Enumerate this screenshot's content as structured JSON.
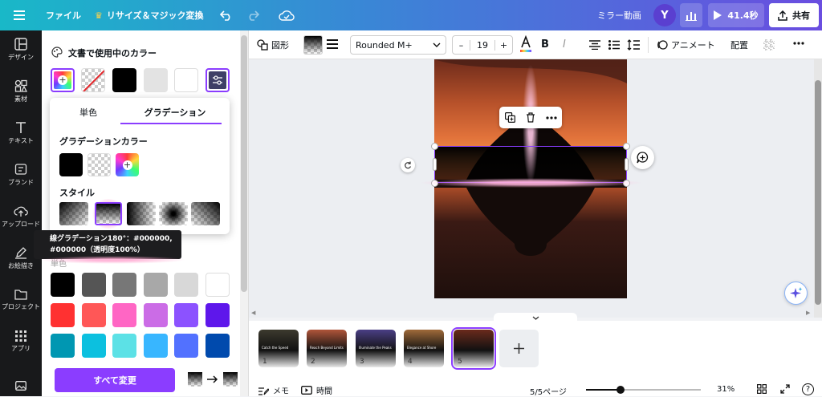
{
  "topbar": {
    "file_label": "ファイル",
    "resize_label": "リサイズ＆マジック変換",
    "mirror_label": "ミラー動画",
    "avatar_letter": "Y",
    "play_time": "41.4秒",
    "share_label": "共有"
  },
  "rail": {
    "items": [
      "デザイン",
      "素材",
      "テキスト",
      "ブランド",
      "アップロード",
      "お絵描き",
      "プロジェクト",
      "アプリ"
    ]
  },
  "panel": {
    "heading": "文書で使用中のカラー",
    "tabs": {
      "solid": "単色",
      "gradient": "グラデーション"
    },
    "gradient_colors_heading": "グラデーションカラー",
    "style_heading": "スタイル",
    "tooltip_line1": "線グラデーション180°：#000000,",
    "tooltip_line2": "#000000（透明度100%）",
    "faded_label": "単色",
    "change_all_label": "すべて変更",
    "palette": [
      [
        "#000000",
        "#555555",
        "#777777",
        "#a8a8a8",
        "#d8d8d8",
        "#ffffff"
      ],
      [
        "#ff3131",
        "#ff5757",
        "#ff66c4",
        "#cb6ce6",
        "#8c52ff",
        "#5e17eb"
      ],
      [
        "#0097b2",
        "#0cc0df",
        "#5ce1e6",
        "#38b6ff",
        "#5271ff",
        "#004aad"
      ]
    ]
  },
  "toolbar": {
    "shape_label": "図形",
    "font_name": "Rounded M+",
    "font_size": "19",
    "minus": "–",
    "plus": "+",
    "bold": "B",
    "italic": "I",
    "animate_label": "アニメート",
    "arrange_label": "配置"
  },
  "thumbnails": [
    {
      "num": "1",
      "caption": "Catch the Speed",
      "bg": "#3c3a2e"
    },
    {
      "num": "2",
      "caption": "Reach Beyond Limits",
      "bg": "#b0553a"
    },
    {
      "num": "3",
      "caption": "Illuminate the Peaks",
      "bg": "#4a3f85"
    },
    {
      "num": "4",
      "caption": "Elegance at Shore",
      "bg": "#a06a3a"
    },
    {
      "num": "5",
      "caption": "",
      "bg": "#6a2a1c"
    }
  ],
  "bottombar": {
    "notes_label": "メモ",
    "time_label": "時間",
    "page_label": "5/5ページ",
    "zoom_label": "31%",
    "zoom_fraction": 0.3
  }
}
